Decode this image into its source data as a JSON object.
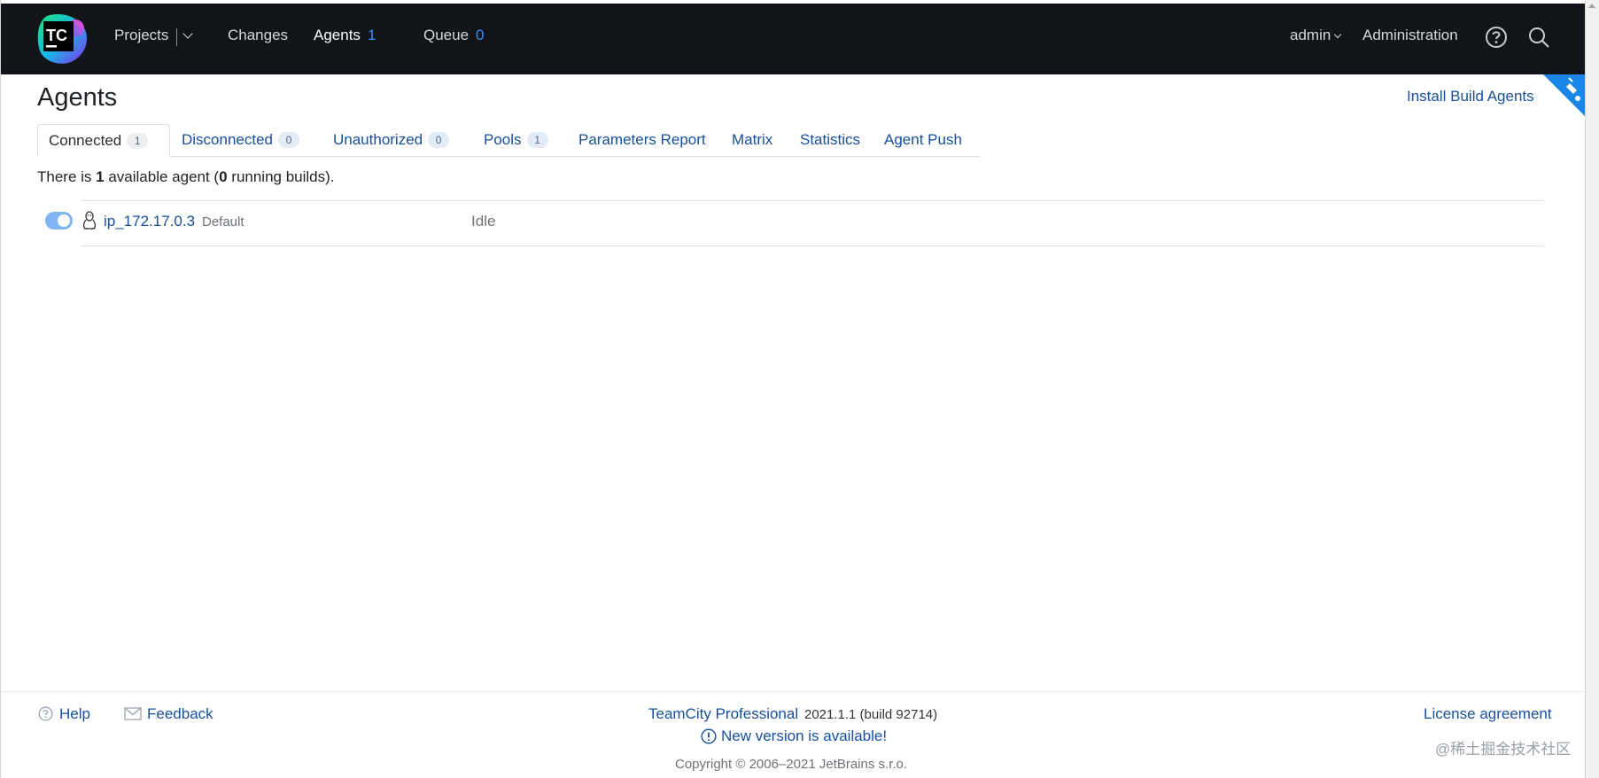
{
  "header": {
    "logo_text": "TC",
    "nav": {
      "projects": "Projects",
      "changes": "Changes",
      "agents": "Agents",
      "agents_count": "1",
      "queue": "Queue",
      "queue_count": "0"
    },
    "user": "admin",
    "administration": "Administration",
    "icons": [
      "help-icon",
      "search-icon"
    ]
  },
  "page": {
    "title": "Agents",
    "install_link": "Install Build Agents"
  },
  "tabs": [
    {
      "label": "Connected",
      "count": "1",
      "selected": true
    },
    {
      "label": "Disconnected",
      "count": "0"
    },
    {
      "label": "Unauthorized",
      "count": "0"
    },
    {
      "label": "Pools",
      "count": "1"
    },
    {
      "label": "Parameters Report"
    },
    {
      "label": "Matrix"
    },
    {
      "label": "Statistics"
    },
    {
      "label": "Agent Push"
    }
  ],
  "summary": {
    "prefix": "There is ",
    "available": "1",
    "middle": " available agent (",
    "running": "0",
    "suffix": " running builds)."
  },
  "agents": [
    {
      "enabled": true,
      "os_icon": "linux-icon",
      "name": "ip_172.17.0.3",
      "pool": "Default",
      "status": "Idle"
    }
  ],
  "footer": {
    "help": "Help",
    "feedback": "Feedback",
    "product": "TeamCity Professional",
    "version": "2021.1.1 (build 92714)",
    "new_version": "New version is available!",
    "copyright": "Copyright © 2006–2021 JetBrains s.r.o.",
    "license": "License agreement",
    "watermark": "@稀土掘金技术社区"
  },
  "colors": {
    "header_bg": "#111418",
    "link": "#17509b",
    "accent": "#3d8ef5",
    "toggle_on": "#7fb6f3"
  }
}
